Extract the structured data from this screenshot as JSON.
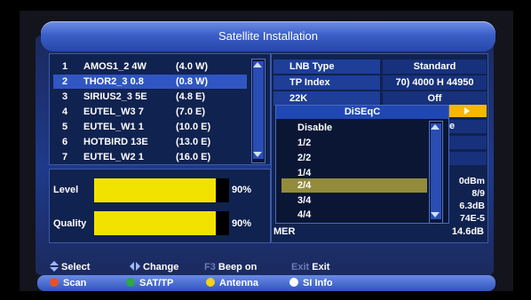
{
  "title": "Satellite Installation",
  "satellites": [
    {
      "num": "1",
      "name": "AMOS1_2 4W",
      "pos": "(4.0 W)"
    },
    {
      "num": "2",
      "name": "THOR2_3 0.8",
      "pos": "(0.8 W)"
    },
    {
      "num": "3",
      "name": "SIRIUS2_3 5E",
      "pos": "(4.8 E)"
    },
    {
      "num": "4",
      "name": "EUTEL_W3 7",
      "pos": "(7.0 E)"
    },
    {
      "num": "5",
      "name": "EUTEL_W1 1",
      "pos": "(10.0 E)"
    },
    {
      "num": "6",
      "name": "HOTBIRD 13E",
      "pos": "(13.0 E)"
    },
    {
      "num": "7",
      "name": "EUTEL_W2 1",
      "pos": "(16.0 E)"
    }
  ],
  "selected_satellite": 2,
  "signal": {
    "level_label": "Level",
    "level_pct": "90%",
    "level_value": 90,
    "quality_label": "Quality",
    "quality_pct": "90%",
    "quality_value": 90
  },
  "settings": {
    "lnb_label": "LNB Type",
    "lnb_value": "Standard",
    "tp_label": "TP Index",
    "tp_value": "70) 4000 H 44950",
    "k22_label": "22K",
    "k22_value": "Off",
    "partial_value": "e"
  },
  "info": {
    "v1": "0dBm",
    "v2": "8/9",
    "v3": "6.3dB",
    "v4": "74E-5",
    "mer_label": "MER",
    "mer_value": "14.6dB"
  },
  "diseqc": {
    "title": "DiSEqC",
    "options": [
      "Disable",
      "1/2",
      "2/2",
      "1/4",
      "2/4",
      "3/4",
      "4/4"
    ],
    "selected": "2/4"
  },
  "help": {
    "select": "Select",
    "change": "Change",
    "f3_key": "F3",
    "f3_label": "Beep on",
    "exit_key": "Exit",
    "exit_label": "Exit"
  },
  "buttons": {
    "scan": "Scan",
    "sattp": "SAT/TP",
    "antenna": "Antenna",
    "siinfo": "SI Info"
  },
  "colors": {
    "bar_fill": "#f2e200",
    "selection": "#2f56c2",
    "dialog_selection": "#938b3c",
    "red": "#e8502a",
    "green": "#2aa84a",
    "yellow": "#f2d21b",
    "white": "#ffffff"
  }
}
